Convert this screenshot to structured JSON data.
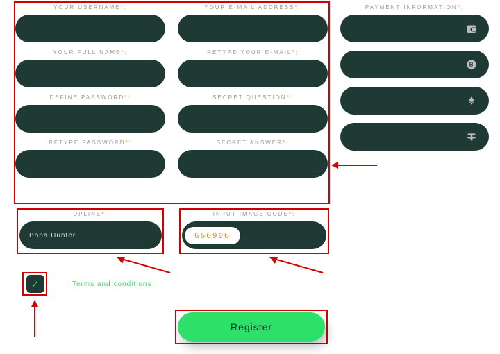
{
  "fields": {
    "username": "YOUR USERNAME",
    "email": "YOUR E-MAIL ADDRESS",
    "fullname": "YOUR FULL NAME",
    "retype_email": "RETYPE YOUR E-MAIL",
    "password": "DEFINE PASSWORD",
    "secret_q": "SECRET QUESTION",
    "retype_password": "RETYPE PASSWORD",
    "secret_a": "SECRET ANSWER"
  },
  "upline": {
    "label": "UPLINE",
    "value": "Bona Hunter"
  },
  "captcha": {
    "label": "INPUT IMAGE CODE",
    "code": "666906"
  },
  "terms": "Terms and conditions",
  "register": "Register",
  "payment": {
    "label": "PAYMENT INFORMATION"
  },
  "ast": "*",
  "colon": ":"
}
